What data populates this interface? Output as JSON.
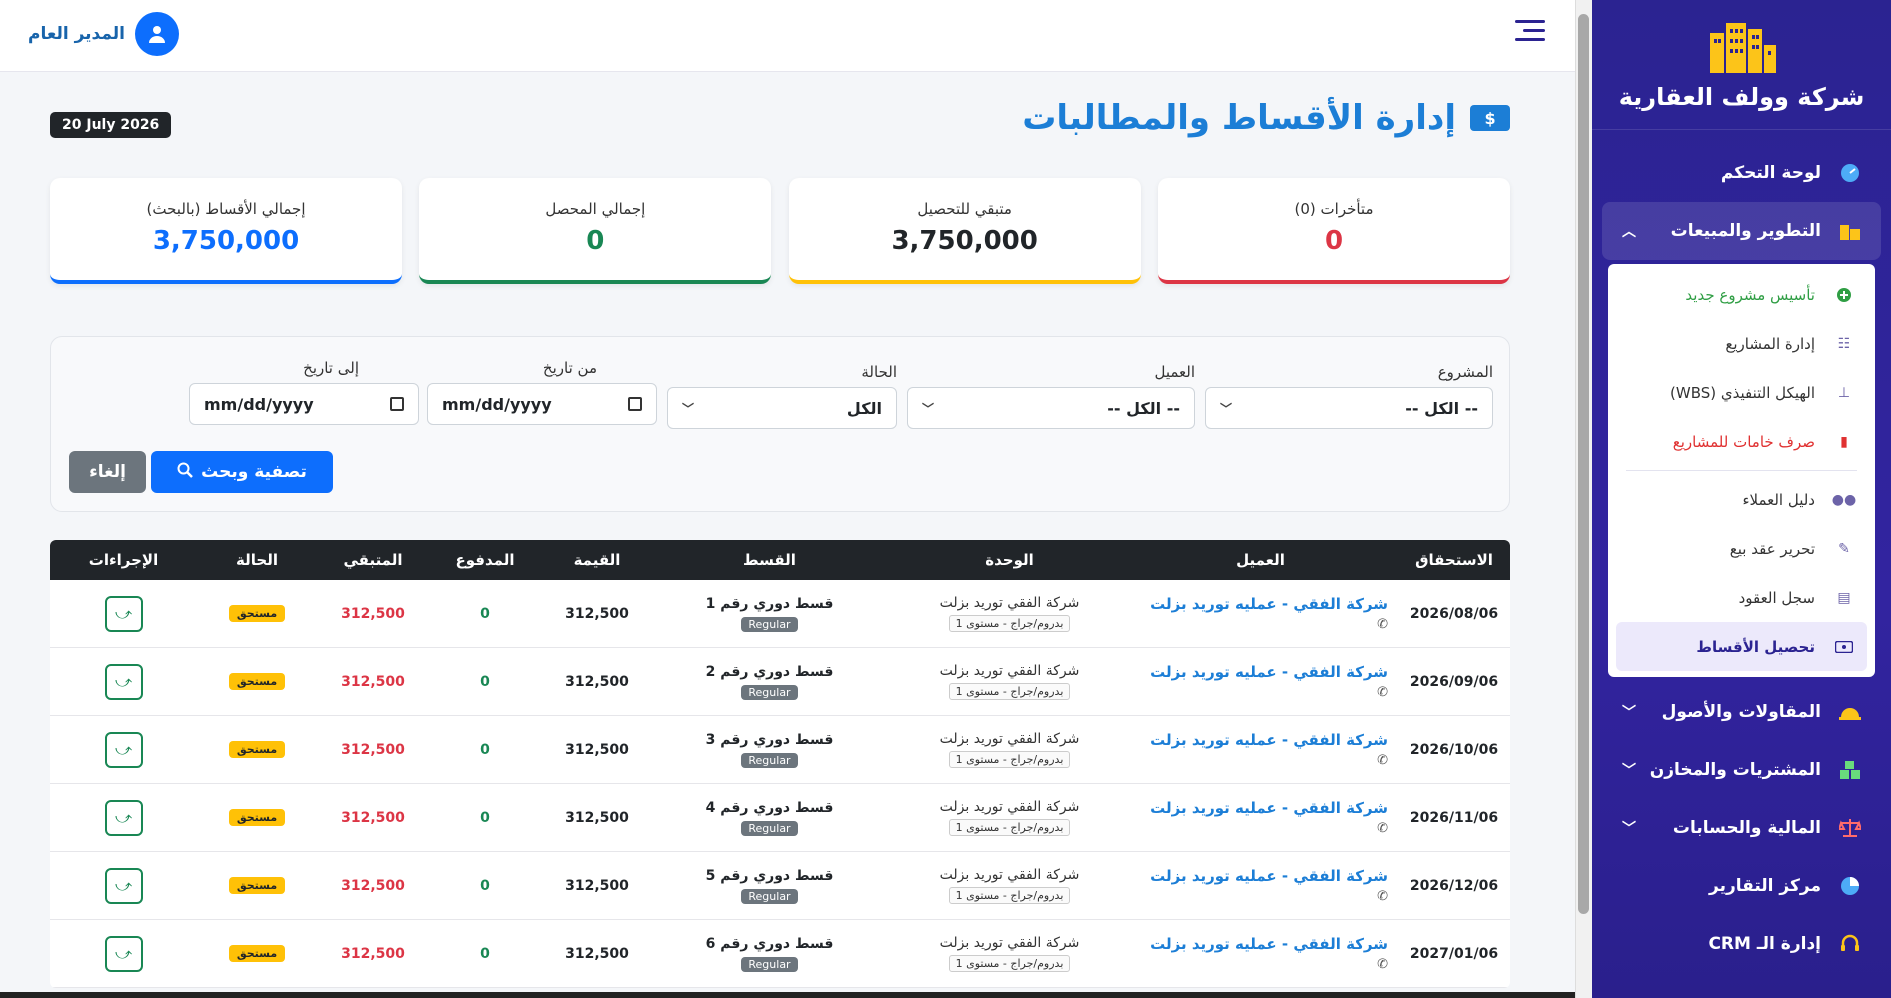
{
  "brand": {
    "name": "شركة وولف العقارية"
  },
  "user": {
    "name": "المدير العام"
  },
  "sidebar": {
    "dashboard": "لوحة التحكم",
    "dev_sales": "التطوير والمبيعات",
    "sub_items": [
      "تأسيس مشروع جديد",
      "إدارة المشاريع",
      "الهيكل التنفيذي (WBS)",
      "صرف خامات للمشاريع",
      "دليل العملاء",
      "تحرير عقد بيع",
      "سجل العقود",
      "تحصيل الأقساط"
    ],
    "contracting": "المقاولات والأصول",
    "purchasing": "المشتريات والمخازن",
    "finance": "المالية والحسابات",
    "reports": "مركز التقارير",
    "crm": "إدارة الـ CRM"
  },
  "page": {
    "title": "إدارة الأقساط والمطالبات",
    "title_icon": "$",
    "date": "20 July 2026"
  },
  "stats": [
    {
      "label": "إجمالي الأقساط (بالبحث)",
      "value": "3,750,000"
    },
    {
      "label": "إجمالي المحصل",
      "value": "0"
    },
    {
      "label": "متبقي للتحصيل",
      "value": "3,750,000"
    },
    {
      "label": "متأخرات (0)",
      "value": "0"
    }
  ],
  "filters": {
    "project_label": "المشروع",
    "project_value": "-- الكل --",
    "client_label": "العميل",
    "client_value": "-- الكل --",
    "status_label": "الحالة",
    "status_value": "الكل",
    "from_label": "من تاريخ",
    "from_value": "mm/dd/yyyy",
    "to_label": "إلى تاريخ",
    "to_value": "mm/dd/yyyy",
    "search_btn": "تصفية وبحث",
    "cancel_btn": "إلغاء"
  },
  "table": {
    "headers": [
      "الاستحقاق",
      "العميل",
      "الوحدة",
      "القسط",
      "القيمة",
      "المدفوع",
      "المتبقي",
      "الحالة",
      "الإجراءات"
    ],
    "rows": [
      {
        "due": "2026/08/06",
        "client": "شركة الفقي - عمليه توريد بزلت",
        "unit": "شركة الفقي توريد بزلت",
        "unit_badge": "بدروم/جراج - مستوى 1",
        "inst": "قسط دوري رقم 1",
        "inst_badge": "Regular",
        "value": "312,500",
        "paid": "0",
        "rem": "312,500",
        "status": "مستحق"
      },
      {
        "due": "2026/09/06",
        "client": "شركة الفقي - عمليه توريد بزلت",
        "unit": "شركة الفقي توريد بزلت",
        "unit_badge": "بدروم/جراج - مستوى 1",
        "inst": "قسط دوري رقم 2",
        "inst_badge": "Regular",
        "value": "312,500",
        "paid": "0",
        "rem": "312,500",
        "status": "مستحق"
      },
      {
        "due": "2026/10/06",
        "client": "شركة الفقي - عمليه توريد بزلت",
        "unit": "شركة الفقي توريد بزلت",
        "unit_badge": "بدروم/جراج - مستوى 1",
        "inst": "قسط دوري رقم 3",
        "inst_badge": "Regular",
        "value": "312,500",
        "paid": "0",
        "rem": "312,500",
        "status": "مستحق"
      },
      {
        "due": "2026/11/06",
        "client": "شركة الفقي - عمليه توريد بزلت",
        "unit": "شركة الفقي توريد بزلت",
        "unit_badge": "بدروم/جراج - مستوى 1",
        "inst": "قسط دوري رقم 4",
        "inst_badge": "Regular",
        "value": "312,500",
        "paid": "0",
        "rem": "312,500",
        "status": "مستحق"
      },
      {
        "due": "2026/12/06",
        "client": "شركة الفقي - عمليه توريد بزلت",
        "unit": "شركة الفقي توريد بزلت",
        "unit_badge": "بدروم/جراج - مستوى 1",
        "inst": "قسط دوري رقم 5",
        "inst_badge": "Regular",
        "value": "312,500",
        "paid": "0",
        "rem": "312,500",
        "status": "مستحق"
      },
      {
        "due": "2027/01/06",
        "client": "شركة الفقي - عمليه توريد بزلت",
        "unit": "شركة الفقي توريد بزلت",
        "unit_badge": "بدروم/جراج - مستوى 1",
        "inst": "قسط دوري رقم 6",
        "inst_badge": "Regular",
        "value": "312,500",
        "paid": "0",
        "rem": "312,500",
        "status": "مستحق"
      }
    ]
  },
  "colors": {
    "sidebar": "#2b2391",
    "primary": "#0d6efd",
    "success": "#198754",
    "warning": "#ffc107",
    "danger": "#dc3545"
  }
}
